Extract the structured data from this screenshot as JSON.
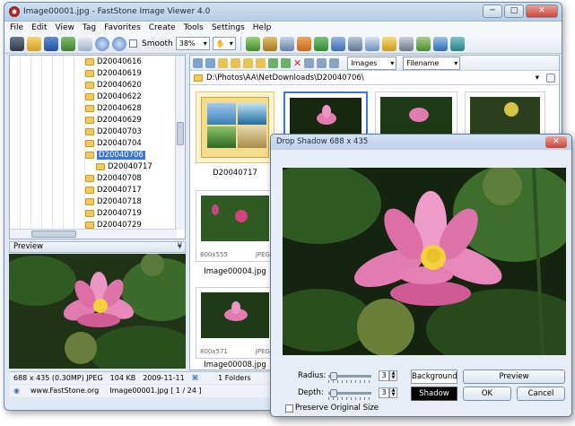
{
  "window": {
    "title": "Image00001.jpg - FastStone Image Viewer 4.0",
    "btn_min": "─",
    "btn_max": "□",
    "btn_close": "✕"
  },
  "menu": [
    "File",
    "Edit",
    "View",
    "Tag",
    "Favorites",
    "Create",
    "Tools",
    "Settings",
    "Help"
  ],
  "toolbar": {
    "smooth_label": "Smooth",
    "zoom_value": "38%"
  },
  "nav": {
    "filter_value": "Images",
    "sort_value": "Filename",
    "address": "D:\\Photos\\AA\\NetDownloads\\D20040706\\"
  },
  "tree": {
    "items": [
      {
        "label": "D20040616"
      },
      {
        "label": "D20040619"
      },
      {
        "label": "D20040620"
      },
      {
        "label": "D20040622"
      },
      {
        "label": "D20040628"
      },
      {
        "label": "D20040629"
      },
      {
        "label": "D20040703"
      },
      {
        "label": "D20040704"
      },
      {
        "label": "D20040706"
      },
      {
        "label": "D20040717"
      },
      {
        "label": "D20040708"
      },
      {
        "label": "D20040717"
      },
      {
        "label": "D20040718"
      },
      {
        "label": "D20040719"
      },
      {
        "label": "D20040729"
      }
    ]
  },
  "preview": {
    "label": "Preview"
  },
  "thumbs": {
    "t1_caption": "D20040717",
    "t2_meta_size": "800x555",
    "t2_meta_type": "JPEG",
    "t2_caption": "Image00004.jpg",
    "t3_meta_size": "800x571",
    "t3_meta_type": "JPEG",
    "t3_caption": "Image00008.jpg"
  },
  "status": {
    "info": "688 x 435 (0.30MP) JPEG",
    "size": "104 KB",
    "date": "2009-11-11",
    "folders": "1 Folders",
    "site": "www.FastStone.org",
    "file": "Image00001.jpg [ 1 / 24 ]"
  },
  "dialog": {
    "title": "Drop Shadow   688 x 435",
    "radius_label": "Radius:",
    "radius_value": "3",
    "depth_label": "Depth:",
    "depth_value": "3",
    "background_label": "Background",
    "shadow_label": "Shadow",
    "preview_btn": "Preview",
    "ok_btn": "OK",
    "cancel_btn": "Cancel",
    "preserve_label": "Preserve Original Size",
    "close": "✕"
  }
}
